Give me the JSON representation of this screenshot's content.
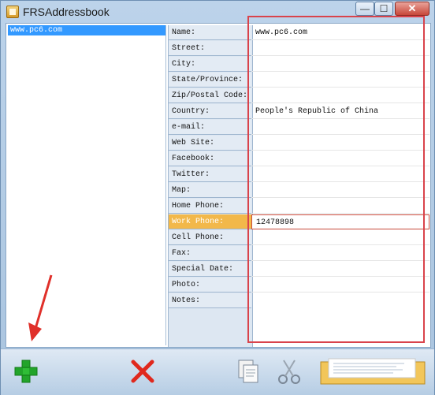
{
  "window": {
    "title": "FRSAddressbook"
  },
  "titlebar": {
    "min": "—",
    "max": "☐",
    "close": "✕"
  },
  "list": {
    "items": [
      "www.pc6.com"
    ]
  },
  "fields": [
    {
      "label": "Name:",
      "value": "www.pc6.com"
    },
    {
      "label": "Street:",
      "value": ""
    },
    {
      "label": "City:",
      "value": ""
    },
    {
      "label": "State/Province:",
      "value": ""
    },
    {
      "label": "Zip/Postal Code:",
      "value": ""
    },
    {
      "label": "Country:",
      "value": "People's Republic of China"
    },
    {
      "label": "e-mail:",
      "value": ""
    },
    {
      "label": "Web Site:",
      "value": ""
    },
    {
      "label": "Facebook:",
      "value": ""
    },
    {
      "label": "Twitter:",
      "value": ""
    },
    {
      "label": "Map:",
      "value": ""
    },
    {
      "label": "Home Phone:",
      "value": ""
    },
    {
      "label": "Work Phone:",
      "value": "12478898"
    },
    {
      "label": "Cell Phone:",
      "value": ""
    },
    {
      "label": "Fax:",
      "value": ""
    },
    {
      "label": "Special Date:",
      "value": ""
    },
    {
      "label": "Photo:",
      "value": ""
    },
    {
      "label": "Notes:",
      "value": ""
    }
  ],
  "toolbar": {
    "icons": [
      "add-icon",
      "delete-icon",
      "copy-icon",
      "cut-icon",
      "paste-icon"
    ],
    "colors": {
      "add": "#22a42a",
      "delete": "#e0281d"
    }
  },
  "annotation": {
    "highlight_color": "#d9434b"
  }
}
